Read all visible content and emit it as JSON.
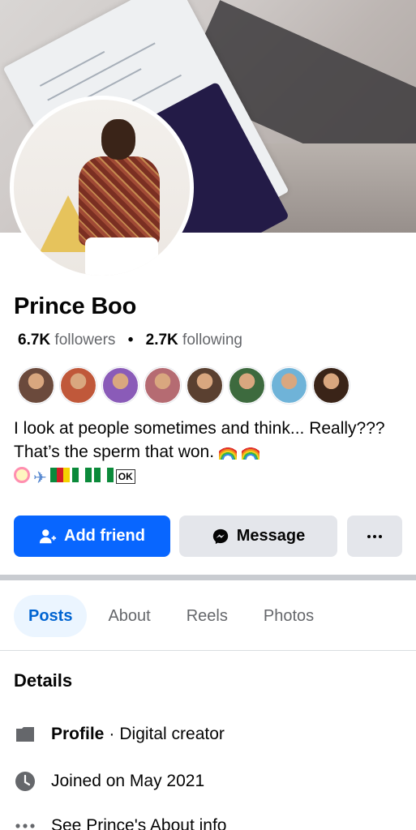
{
  "profile": {
    "name": "Prince Boo",
    "followers_count": "6.7K",
    "followers_label": "followers",
    "following_count": "2.7K",
    "following_label": "following",
    "bio_text": "I look at people sometimes and think... Really??? That’s the sperm that won.",
    "bio_emoji_ok": "OK"
  },
  "friends": [
    {
      "color": "#6b4a3c"
    },
    {
      "color": "#c0583a"
    },
    {
      "color": "#8a5bb8"
    },
    {
      "color": "#b56b72"
    },
    {
      "color": "#5a4030"
    },
    {
      "color": "#3d6a3e"
    },
    {
      "color": "#6fb3d8"
    },
    {
      "color": "#3a2418"
    }
  ],
  "actions": {
    "add_friend": "Add friend",
    "message": "Message"
  },
  "tabs": [
    {
      "label": "Posts",
      "active": true
    },
    {
      "label": "About",
      "active": false
    },
    {
      "label": "Reels",
      "active": false
    },
    {
      "label": "Photos",
      "active": false
    }
  ],
  "details": {
    "title": "Details",
    "profile_label": "Profile",
    "profile_value": "Digital creator",
    "joined": "Joined on May 2021",
    "see_about": "See Prince's About info"
  },
  "colors": {
    "primary": "#0866ff",
    "tab_active_bg": "#ebf5ff",
    "secondary_button": "#e4e6eb"
  }
}
